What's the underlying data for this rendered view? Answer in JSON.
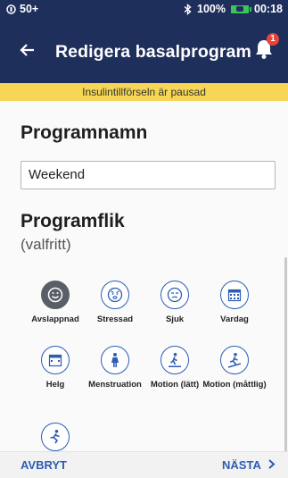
{
  "status_bar": {
    "signal": "50+",
    "battery_percent": "100%",
    "time": "00:18",
    "battery_color": "#3ec25a"
  },
  "header": {
    "title": "Redigera basalprogram",
    "notification_count": "1",
    "background": "#1f2f5c"
  },
  "banner": {
    "text": "Insulintillförseln är pausad",
    "color": "#f7d655"
  },
  "form": {
    "name_heading": "Programnamn",
    "name_value": "Weekend",
    "tag_heading": "Programflik",
    "tag_optional": "(valfritt)",
    "tags": [
      {
        "label": "Avslappnad",
        "icon": "smiley-icon",
        "selected": true
      },
      {
        "label": "Stressad",
        "icon": "stressed-face-icon",
        "selected": false
      },
      {
        "label": "Sjuk",
        "icon": "sick-face-icon",
        "selected": false
      },
      {
        "label": "Vardag",
        "icon": "calendar-weekday-icon",
        "selected": false
      },
      {
        "label": "Helg",
        "icon": "calendar-weekend-icon",
        "selected": false
      },
      {
        "label": "Menstruation",
        "icon": "female-figure-icon",
        "selected": false
      },
      {
        "label": "Motion (lätt)",
        "icon": "walking-icon",
        "selected": false
      },
      {
        "label": "Motion (måttlig)",
        "icon": "jogging-icon",
        "selected": false
      },
      {
        "label": "",
        "icon": "running-icon",
        "selected": false
      }
    ]
  },
  "footer": {
    "cancel_label": "AVBRYT",
    "next_label": "NÄSTA",
    "accent": "#2b5db3"
  }
}
